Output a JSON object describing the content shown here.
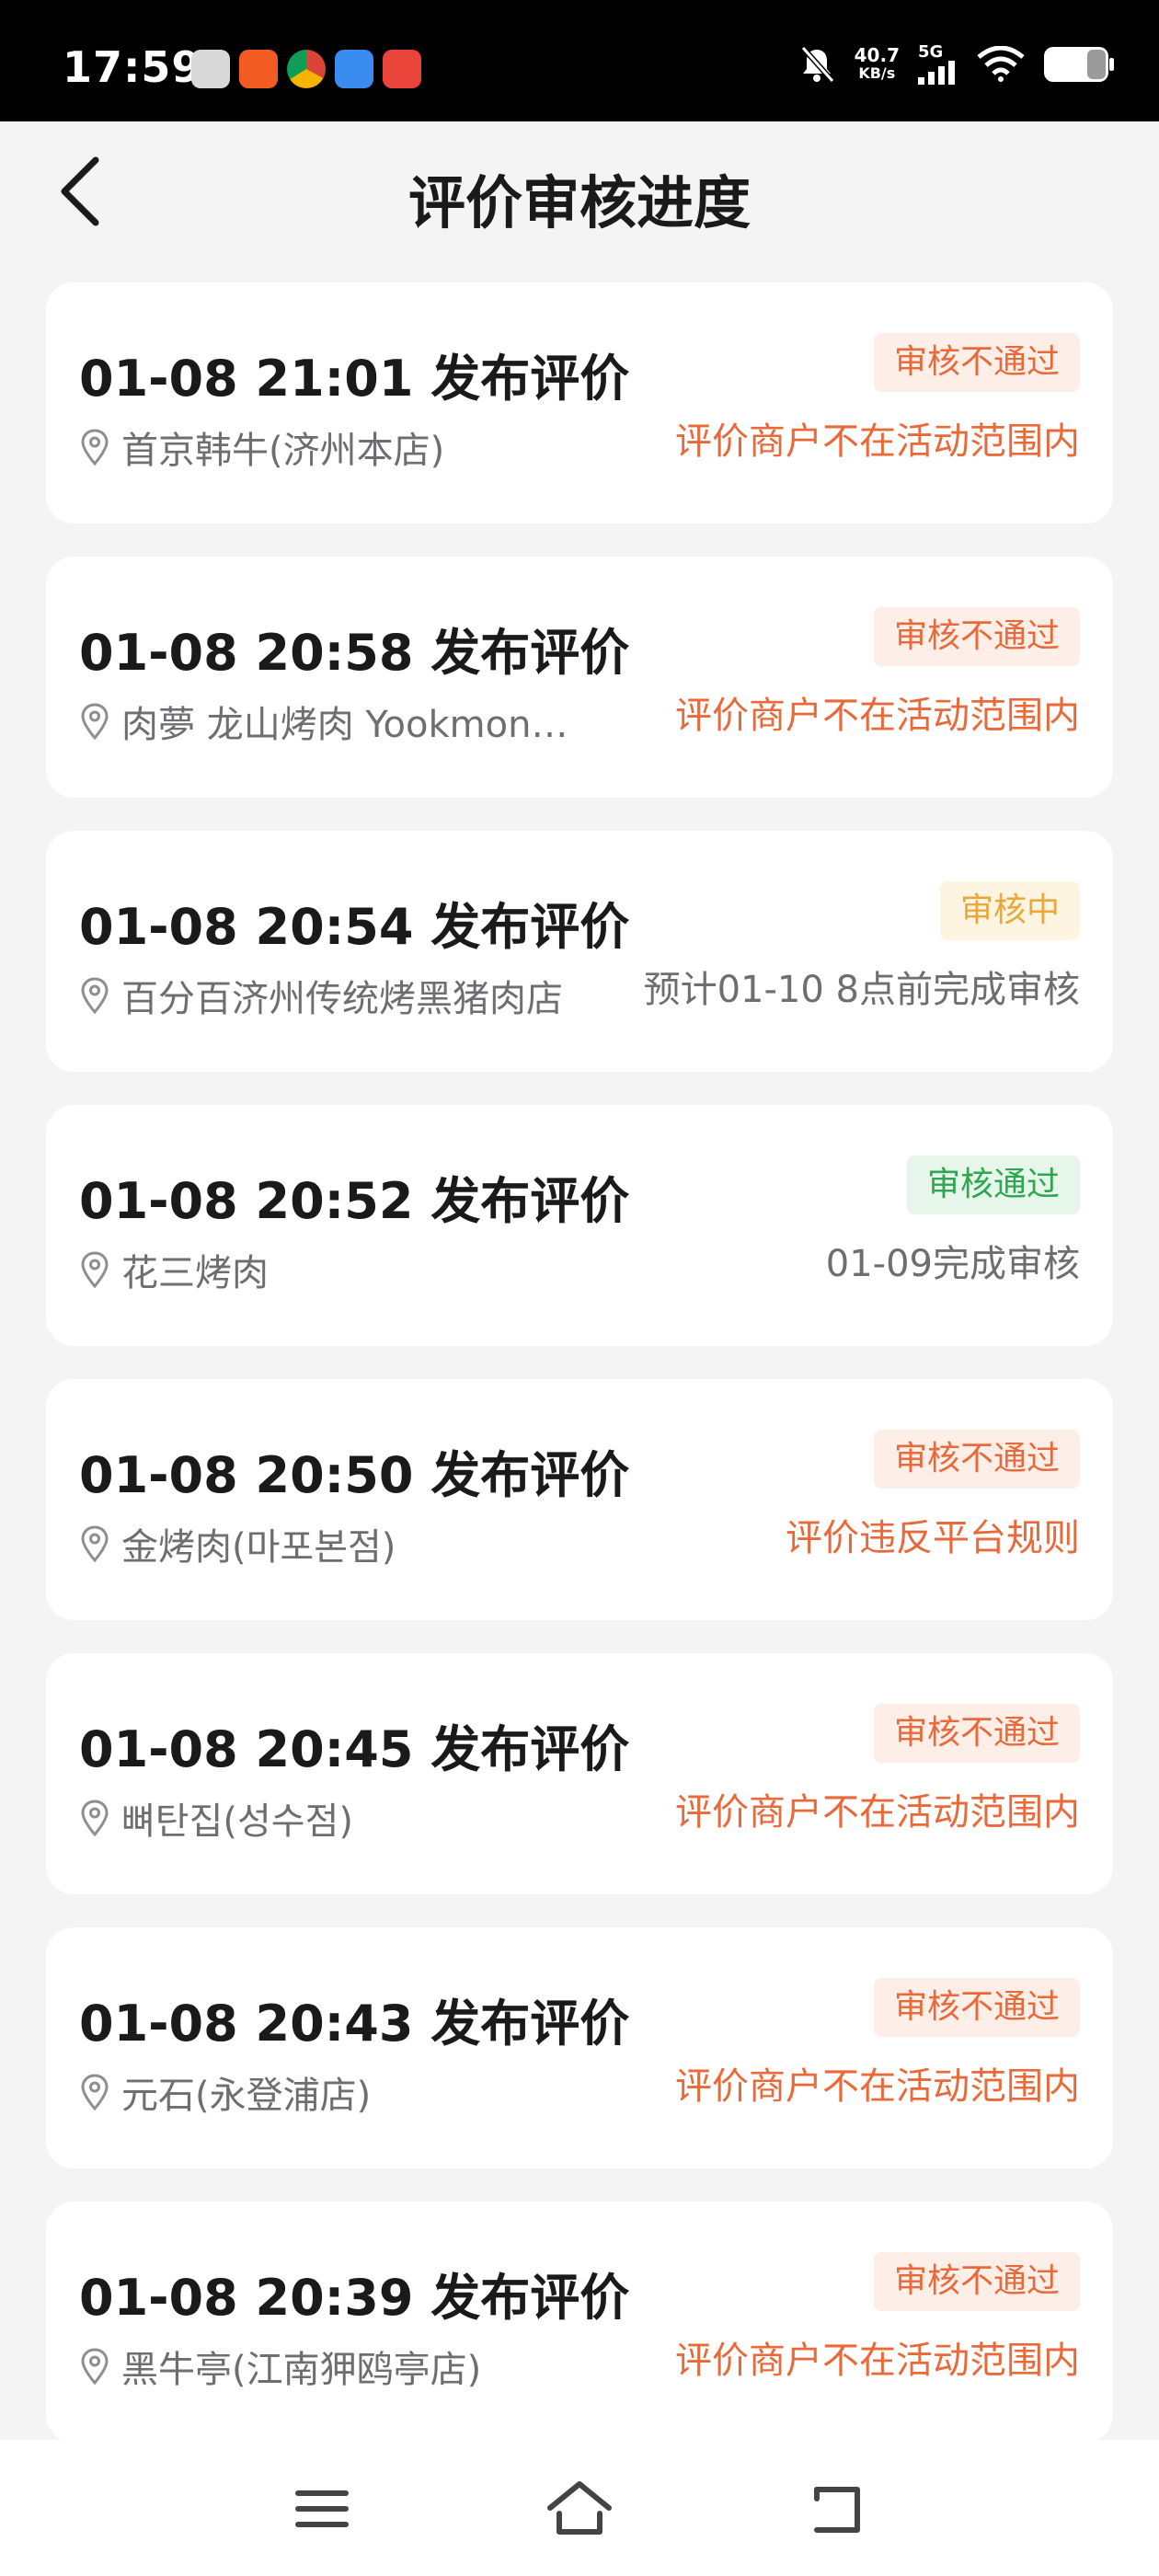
{
  "status_bar": {
    "time": "17:59",
    "net_speed_value": "40.7",
    "net_speed_unit": "KB/s",
    "network_type": "5G",
    "icons": [
      "settings-app-icon",
      "taobao-app-icon",
      "chrome-app-icon",
      "cloud-app-icon",
      "game-app-icon",
      "bell-muted-icon",
      "signal-icon",
      "wifi-icon",
      "battery-icon"
    ]
  },
  "header": {
    "title": "评价审核进度",
    "back_icon": "chevron-left-icon"
  },
  "colors": {
    "fail": "#e86a3a",
    "pending": "#e9a93a",
    "pass": "#2fa64f",
    "background": "#f4f4f5"
  },
  "reviews": [
    {
      "title": "01-08 21:01 发布评价",
      "status": "审核不通过",
      "status_type": "fail",
      "store": "首京韩牛(济州本店)",
      "reason": "评价商户不在活动范围内"
    },
    {
      "title": "01-08 20:58 发布评价",
      "status": "审核不通过",
      "status_type": "fail",
      "store": "肉夢 龙山烤肉 Yookmon…",
      "reason": "评价商户不在活动范围内"
    },
    {
      "title": "01-08 20:54 发布评价",
      "status": "审核中",
      "status_type": "pending",
      "store": "百分百济州传统烤黑猪肉店",
      "reason": "预计01-10 8点前完成审核"
    },
    {
      "title": "01-08 20:52 发布评价",
      "status": "审核通过",
      "status_type": "pass",
      "store": "花三烤肉",
      "reason": "01-09完成审核"
    },
    {
      "title": "01-08 20:50 发布评价",
      "status": "审核不通过",
      "status_type": "fail",
      "store": "金烤肉(마포본점)",
      "reason": "评价违反平台规则"
    },
    {
      "title": "01-08 20:45 发布评价",
      "status": "审核不通过",
      "status_type": "fail",
      "store": "뼈탄집(성수점)",
      "reason": "评价商户不在活动范围内"
    },
    {
      "title": "01-08 20:43 发布评价",
      "status": "审核不通过",
      "status_type": "fail",
      "store": "元石(永登浦店)",
      "reason": "评价商户不在活动范围内"
    },
    {
      "title": "01-08 20:39 发布评价",
      "status": "审核不通过",
      "status_type": "fail",
      "store": "黑牛亭(江南狎鸥亭店)",
      "reason": "评价商户不在活动范围内"
    }
  ],
  "nav_bar": {
    "buttons": [
      "menu-icon",
      "home-icon",
      "back-icon"
    ]
  }
}
